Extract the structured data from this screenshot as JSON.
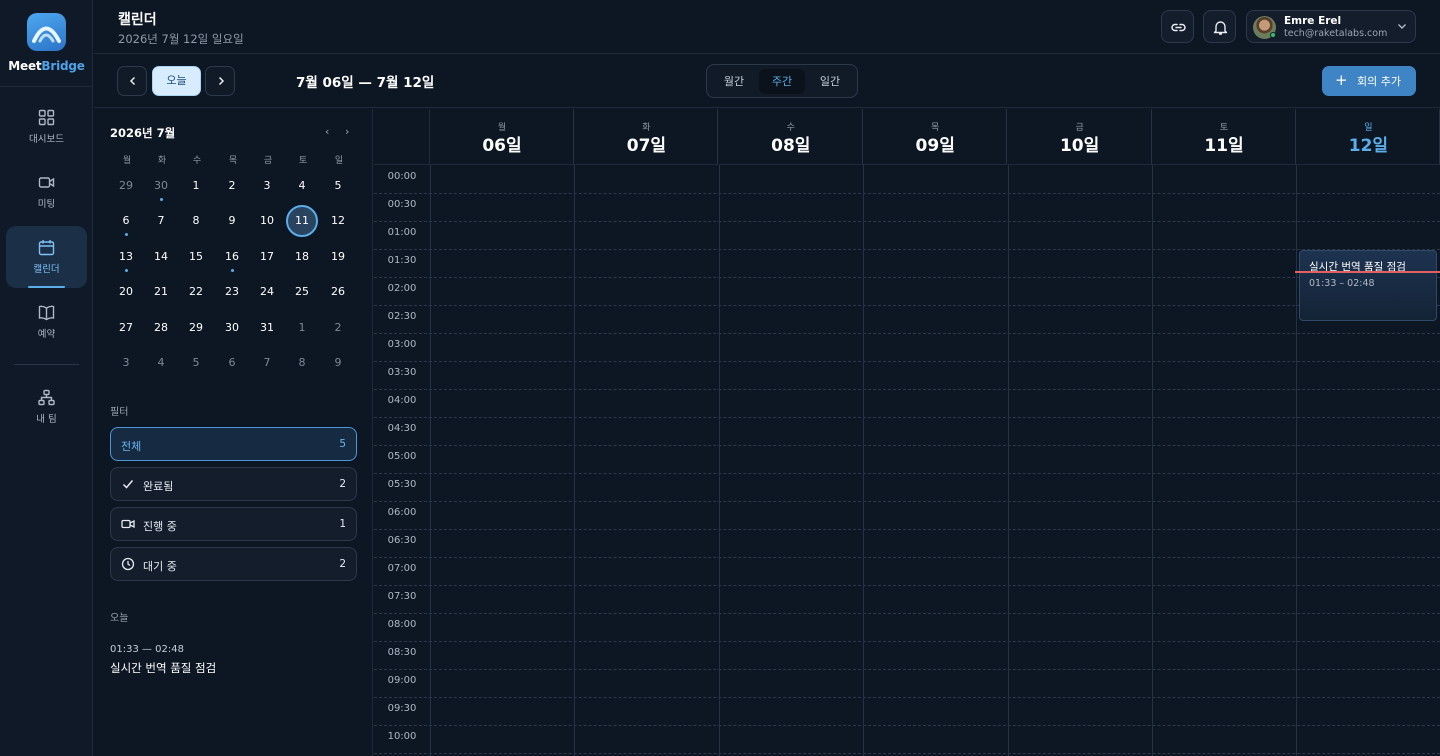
{
  "brand": {
    "part1": "Meet",
    "part2": "Bridge"
  },
  "sidebar": {
    "items": [
      {
        "label": "대시보드",
        "icon": "grid-icon"
      },
      {
        "label": "미팅",
        "icon": "video-icon"
      },
      {
        "label": "캘린더",
        "icon": "calendar-icon",
        "active": true
      },
      {
        "label": "예약",
        "icon": "book-icon"
      },
      {
        "label": "내 팀",
        "icon": "team-icon"
      }
    ]
  },
  "header": {
    "title": "캘린더",
    "subtitle": "2026년 7월 12일 일요일",
    "user": {
      "name": "Emre Erel",
      "email": "tech@raketalabs.com",
      "status": "online"
    }
  },
  "toolbar": {
    "today_label": "오늘",
    "range_label": "7월 06일 — 7월 12일",
    "views": [
      "월간",
      "주간",
      "일간"
    ],
    "active_view": "주간",
    "add_label": "회의 추가"
  },
  "mini_calendar": {
    "title": "2026년 7월",
    "weekdays": [
      "월",
      "화",
      "수",
      "목",
      "금",
      "토",
      "일"
    ],
    "weeks": [
      [
        "29",
        "30",
        "1",
        "2",
        "3",
        "4",
        "5"
      ],
      [
        "6",
        "7",
        "8",
        "9",
        "10",
        "11",
        "12"
      ],
      [
        "13",
        "14",
        "15",
        "16",
        "17",
        "18",
        "19"
      ],
      [
        "20",
        "21",
        "22",
        "23",
        "24",
        "25",
        "26"
      ],
      [
        "27",
        "28",
        "29",
        "30",
        "31",
        "1",
        "2"
      ],
      [
        "3",
        "4",
        "5",
        "6",
        "7",
        "8",
        "9"
      ]
    ],
    "selected": "11"
  },
  "filters": {
    "label": "필터",
    "items": [
      {
        "label": "전체",
        "count": "5",
        "active": true
      },
      {
        "label": "완료됨",
        "count": "2",
        "icon": "check-icon"
      },
      {
        "label": "진행 중",
        "count": "1",
        "icon": "video-icon"
      },
      {
        "label": "대기 중",
        "count": "2",
        "icon": "clock-icon"
      }
    ]
  },
  "today": {
    "label": "오늘",
    "items": [
      {
        "time": "01:33 — 02:48",
        "title": "실시간 번역 품질 점검"
      }
    ]
  },
  "week": {
    "days": [
      {
        "name": "월",
        "num": "06일"
      },
      {
        "name": "화",
        "num": "07일"
      },
      {
        "name": "수",
        "num": "08일"
      },
      {
        "name": "목",
        "num": "09일"
      },
      {
        "name": "금",
        "num": "10일"
      },
      {
        "name": "토",
        "num": "11일"
      },
      {
        "name": "일",
        "num": "12일",
        "today": true
      }
    ],
    "times": [
      "00:00",
      "00:30",
      "01:00",
      "01:30",
      "02:00",
      "02:30",
      "03:00",
      "03:30",
      "04:00",
      "04:30",
      "05:00",
      "05:30",
      "06:00",
      "06:30",
      "07:00",
      "07:30",
      "08:00",
      "08:30",
      "09:00",
      "09:30",
      "10:00"
    ],
    "events": [
      {
        "title": "실시간 번역 품질 점검",
        "time": "01:33 – 02:48",
        "day": "일"
      }
    ]
  },
  "colors": {
    "accent": "#5aaeea",
    "primary_button": "#3f84c4",
    "now_line": "#e2605f",
    "background": "#0d1623"
  }
}
